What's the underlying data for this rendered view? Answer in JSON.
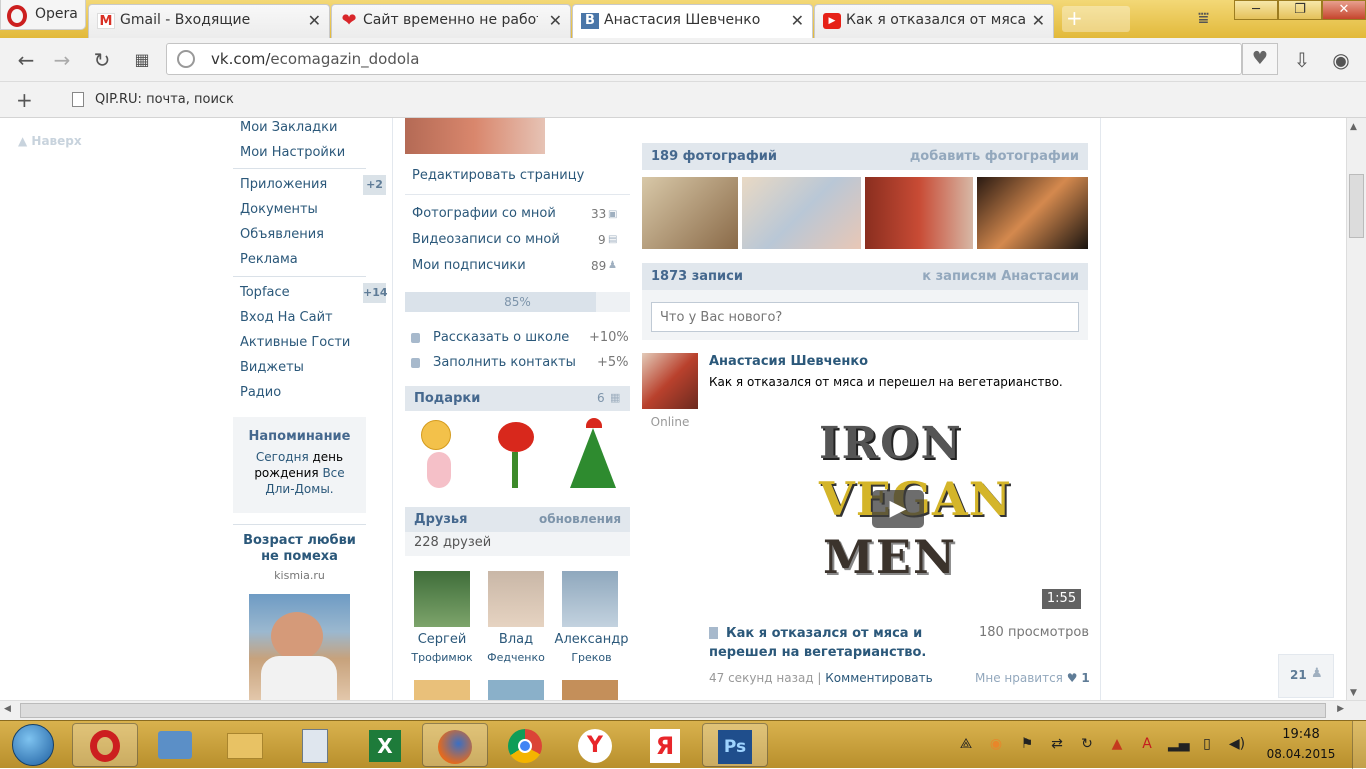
{
  "browser": {
    "app_name": "Opera",
    "tabs": [
      {
        "label": "Gmail - Входящие",
        "icon": "gmail-icon"
      },
      {
        "label": "Сайт временно не работает",
        "icon": "heart-icon"
      },
      {
        "label": "Анастасия Шевченко",
        "icon": "vk-icon",
        "active": true
      },
      {
        "label": "Как я отказался от мяса и",
        "icon": "youtube-icon"
      }
    ],
    "url_host": "vk.com/",
    "url_path": "ecomagazin_dodola",
    "bookmark": "QIP.RU: почта, поиск",
    "window_buttons": [
      "─",
      "❐",
      "✕"
    ]
  },
  "left_menu": {
    "back_top": "Наверх",
    "items_group1": [
      "Мои Закладки",
      "Мои Настройки"
    ],
    "items_group2": [
      {
        "label": "Приложения",
        "badge": "+2"
      },
      {
        "label": "Документы"
      },
      {
        "label": "Объявления"
      },
      {
        "label": "Реклама"
      }
    ],
    "items_group3": [
      {
        "label": "Topface",
        "badge": "+14"
      },
      {
        "label": "Вход На Сайт"
      },
      {
        "label": "Активные Гости"
      },
      {
        "label": "Виджеты"
      },
      {
        "label": "Радио"
      }
    ],
    "reminder": {
      "title": "Напоминание",
      "text_link1": "Сегодня",
      "text_plain": " день рождения ",
      "text_link2": "Все Дли-Домы."
    },
    "ad": {
      "title": "Возраст любви не помеха",
      "domain": "kismia.ru"
    }
  },
  "profile_col": {
    "edit_page": "Редактировать страницу",
    "stats": [
      {
        "label": "Фотографии со мной",
        "count": "33"
      },
      {
        "label": "Видеозаписи со мной",
        "count": "9"
      },
      {
        "label": "Мои подписчики",
        "count": "89"
      }
    ],
    "progress_label": "85%",
    "progress": 0.85,
    "tasks": [
      {
        "label": "Рассказать о школе",
        "gain": "+10%"
      },
      {
        "label": "Заполнить контакты",
        "gain": "+5%"
      }
    ],
    "gifts_title": "Подарки",
    "gifts_count": "6",
    "friends_title": "Друзья",
    "friends_updates": "обновления",
    "friends_count": "228 друзей",
    "friends": [
      {
        "first": "Сергей",
        "last": "Трофимюк"
      },
      {
        "first": "Влад",
        "last": "Федченко"
      },
      {
        "first": "Александр",
        "last": "Греков"
      }
    ]
  },
  "main_col": {
    "photos_title": "189 фотографий",
    "photos_add": "добавить фотографии",
    "wall_title": "1873 записи",
    "wall_link": "к записям Анастасии",
    "post_placeholder": "Что у Вас нового?",
    "post": {
      "author": "Анастасия Шевченко",
      "text": "Как я отказался от мяса и перешел на вегетарианство.",
      "online": "Online",
      "video_logo_line1": "IRON",
      "video_logo_line2": "VEGAN",
      "video_logo_line3": "MEN",
      "duration": "1:55",
      "video_title": "Как я отказался от мяса и перешел на вегетарианство.",
      "views": "180 просмотров",
      "time": "47 секунд назад",
      "comment": "Комментировать",
      "like_label": "Мне нравится",
      "like_count": "1"
    },
    "online_count": "21"
  },
  "taskbar": {
    "time": "19:48",
    "date": "08.04.2015",
    "colors": {
      "opera": "#cc1f1f",
      "excel": "#1e7b3a",
      "ps": "#1f4e8c",
      "yandex": "#e8262a"
    }
  }
}
